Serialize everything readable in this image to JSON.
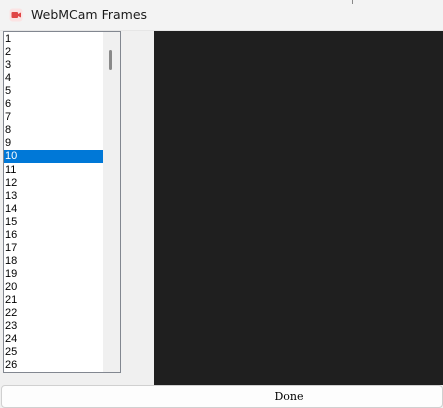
{
  "window": {
    "title": "WebMCam Frames",
    "app_icon": "webmcam-camera-icon"
  },
  "frames": {
    "items": [
      "1",
      "2",
      "3",
      "4",
      "5",
      "6",
      "7",
      "8",
      "9",
      "10",
      "11",
      "12",
      "13",
      "14",
      "15",
      "16",
      "17",
      "18",
      "19",
      "20",
      "21",
      "22",
      "23",
      "24",
      "25",
      "26"
    ],
    "selected": "10"
  },
  "preview": {
    "background": "#1f1f1f"
  },
  "actions": {
    "done_label": "Done"
  },
  "colors": {
    "selection": "#0078d7",
    "window_bg": "#f0f0f0"
  }
}
